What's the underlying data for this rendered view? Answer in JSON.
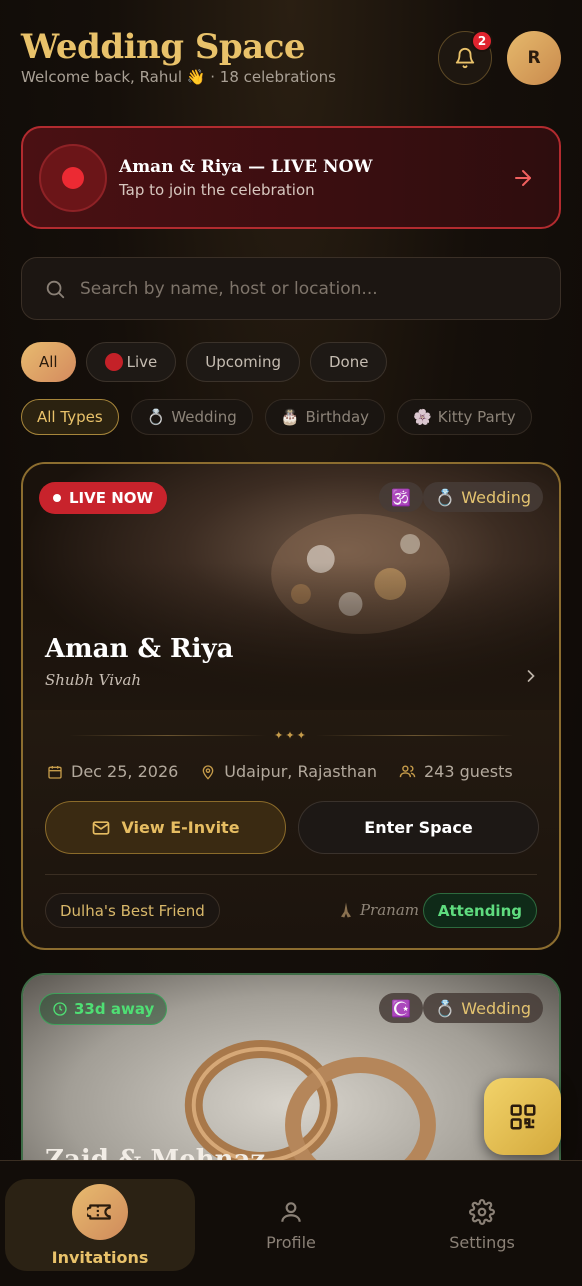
{
  "header": {
    "title": "Wedding Space",
    "subtitle": "Welcome back, Rahul 👋 · 18 celebrations",
    "notification_count": "2",
    "avatar_initial": "R"
  },
  "live_banner": {
    "title": "Aman & Riya — LIVE NOW",
    "subtitle": "Tap to join the celebration"
  },
  "search": {
    "placeholder": "Search by name, host or location..."
  },
  "status_filters": [
    {
      "label": "All",
      "active": true
    },
    {
      "label": "Live",
      "active": false
    },
    {
      "label": "Upcoming",
      "active": false
    },
    {
      "label": "Done",
      "active": false
    }
  ],
  "type_filters": [
    {
      "label": "All Types",
      "emoji": "",
      "active": true
    },
    {
      "label": "Wedding",
      "emoji": "💍",
      "active": false
    },
    {
      "label": "Birthday",
      "emoji": "🎂",
      "active": false
    },
    {
      "label": "Kitty Party",
      "emoji": "🌸",
      "active": false
    }
  ],
  "events": [
    {
      "status_badge": "LIVE NOW",
      "religion_icon": "🕉️",
      "type_emoji": "💍",
      "type_label": "Wedding",
      "title": "Aman & Riya",
      "subtitle": "Shubh Vivah",
      "date": "Dec 25, 2026",
      "location": "Udaipur, Rajasthan",
      "guests": "243 guests",
      "invite_button": "View E-Invite",
      "enter_button": "Enter Space",
      "role": "Dulha's Best Friend",
      "pranam": "Pranam",
      "rsvp": "Attending"
    },
    {
      "status_badge": "33d away",
      "religion_icon": "☪️",
      "type_emoji": "💍",
      "type_label": "Wedding",
      "title": "Zaid & Mehnaz"
    }
  ],
  "nav": {
    "invitations": "Invitations",
    "profile": "Profile",
    "settings": "Settings"
  },
  "colors": {
    "accent_gold": "#e9c26a",
    "live_red": "#c8232c",
    "attending_green": "#5fdc7f"
  }
}
